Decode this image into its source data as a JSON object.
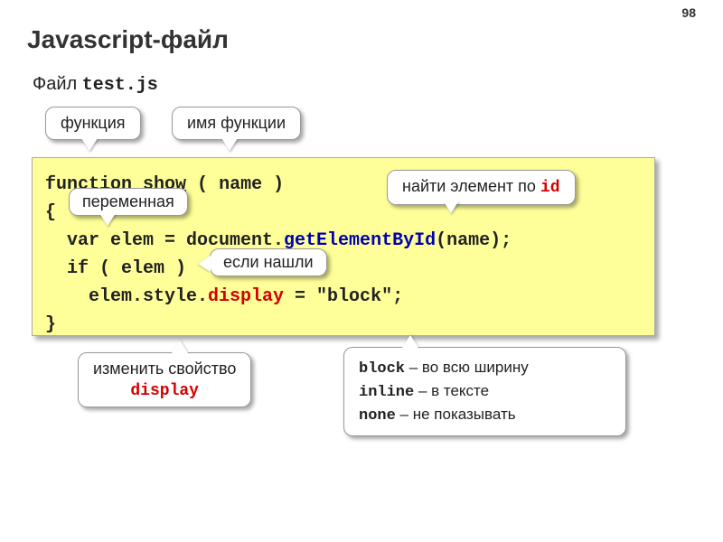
{
  "page_number": "98",
  "title": "Javascript-файл",
  "subtitle_prefix": "Файл ",
  "subtitle_filename": "test.js",
  "callouts": {
    "function_kw": "функция",
    "function_name": "имя функции",
    "variable": "переменная",
    "find_by_id_prefix": "найти элемент по ",
    "find_by_id_key": "id",
    "if_found": "если нашли",
    "change_display_line1": "изменить свойство",
    "change_display_line2": "display",
    "values": {
      "block_kw": "block",
      "block_desc": " – во всю ширину",
      "inline_kw": "inline",
      "inline_desc": " – в тексте",
      "none_kw": "none",
      "none_desc": " – не показывать"
    }
  },
  "code": {
    "l1_a": "function",
    "l1_b": " ",
    "l1_c": "show",
    "l1_d": " ( ",
    "l1_e": "name",
    "l1_f": " )",
    "l2": "{",
    "l3_a": "  var elem = document.",
    "l3_b": "getElementById",
    "l3_c": "(name);",
    "l4": "  if ( elem )",
    "l5_a": "    elem.style.",
    "l5_b": "display",
    "l5_c": " = \"block\";",
    "l6": "}"
  }
}
